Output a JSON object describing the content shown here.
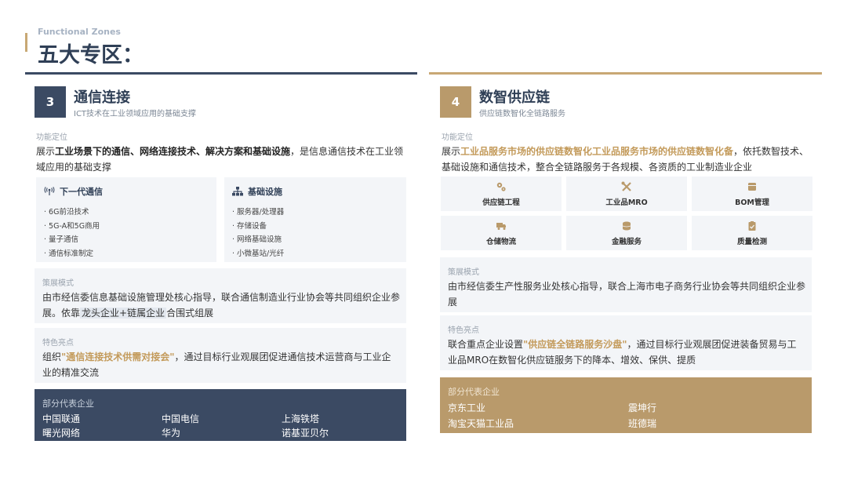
{
  "header": {
    "subtitle": "Functional Zones",
    "title": "五大专区："
  },
  "zone3": {
    "number": "3",
    "title": "通信连接",
    "subtitle": "ICT技术在工业领域应用的基础支撑",
    "position_label": "功能定位",
    "position_pre": "展示",
    "position_bold": "工业场景下的通信、网络连接技术、解决方案和基础设施",
    "position_post": "，是信息通信技术在工业领域应用的基础支撑",
    "card1": {
      "icon": "signal-icon",
      "title": "下一代通信",
      "items": [
        "· 6G前沿技术",
        "· 5G-A和5G商用",
        "· 量子通信",
        "· 通信标准制定"
      ]
    },
    "card2": {
      "icon": "network-icon",
      "title": "基础设施",
      "items": [
        "· 服务器/处理器",
        "· 存储设备",
        "· 网络基础设施",
        "· 小微基站/光纤"
      ]
    },
    "plan_label": "策展模式",
    "plan_text_1": "由市经信委信息基础设施管理处核心指导，联合通信制造业行业协会等共同组织企业参展。依靠",
    "plan_highlight": "龙头企业+链属企业",
    "plan_text_2": "合围式组展",
    "feature_label": "特色亮点",
    "feature_pre": "组织",
    "feature_gold": "\"通信连接技术供需对接会\"",
    "feature_post": "，通过目标行业观展团促进通信技术运营商与工业企业的精准交流",
    "reps_label": "部分代表企业",
    "reps": [
      "中国联通",
      "中国电信",
      "上海铁塔",
      "曙光网络",
      "华为",
      "诺基亚贝尔"
    ]
  },
  "zone4": {
    "number": "4",
    "title": "数智供应链",
    "subtitle": "供应链数智化全链路服务",
    "position_label": "功能定位",
    "position_pre": "展示",
    "position_gold": "工业品服务市场的供应链数智化工业品服务市场的供应链数智化备",
    "position_post": "，依托数智技术、基础设施和通信技术，整合全链路服务于各规模、各资质的工业制造业企业",
    "services": [
      {
        "icon": "gears-icon",
        "label": "供应链工程"
      },
      {
        "icon": "tools-icon",
        "label": "工业品MRO"
      },
      {
        "icon": "box-icon",
        "label": "BOM管理"
      },
      {
        "icon": "truck-icon",
        "label": "仓储物流"
      },
      {
        "icon": "coins-icon",
        "label": "金融服务"
      },
      {
        "icon": "clipboard-check-icon",
        "label": "质量检测"
      }
    ],
    "plan_label": "策展模式",
    "plan_text": "由市经信委生产性服务业处核心指导，联合上海市电子商务行业协会等共同组织企业参展",
    "feature_label": "特色亮点",
    "feature_pre": "联合重点企业设置",
    "feature_gold": "\"供应链全链路服务沙盘\"",
    "feature_post": "，通过目标行业观展团促进装备贸易与工业品MRO在数智化供应链服务下的降本、增效、保供、提质",
    "reps_label": "部分代表企业",
    "reps": [
      "京东工业",
      "震坤行",
      "淘宝天猫工业品",
      "班德瑞"
    ]
  },
  "colors": {
    "navy": "#3b4a63",
    "gold": "#b99a6b",
    "gold_text": "#c39a5a",
    "panel_bg": "#f3f5f8"
  }
}
